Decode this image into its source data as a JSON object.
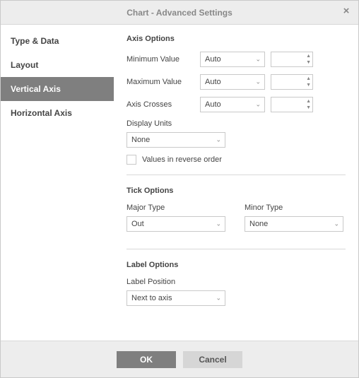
{
  "dialog": {
    "title": "Chart - Advanced Settings"
  },
  "sidebar": {
    "items": [
      {
        "label": "Type & Data"
      },
      {
        "label": "Layout"
      },
      {
        "label": "Vertical Axis"
      },
      {
        "label": "Horizontal Axis"
      }
    ]
  },
  "panel": {
    "axis_options": {
      "title": "Axis Options",
      "min_label": "Minimum Value",
      "min_combo": "Auto",
      "min_spin": "",
      "max_label": "Maximum Value",
      "max_combo": "Auto",
      "max_spin": "",
      "cross_label": "Axis Crosses",
      "cross_combo": "Auto",
      "cross_spin": "",
      "units_label": "Display Units",
      "units_combo": "None",
      "reverse_label": "Values in reverse order"
    },
    "tick_options": {
      "title": "Tick Options",
      "major_label": "Major Type",
      "major_combo": "Out",
      "minor_label": "Minor Type",
      "minor_combo": "None"
    },
    "label_options": {
      "title": "Label Options",
      "pos_label": "Label Position",
      "pos_combo": "Next to axis"
    }
  },
  "footer": {
    "ok": "OK",
    "cancel": "Cancel"
  }
}
